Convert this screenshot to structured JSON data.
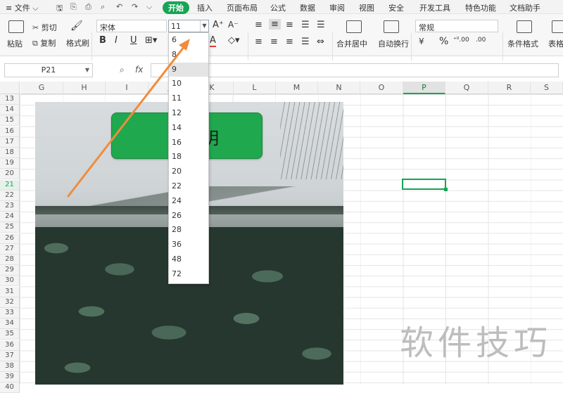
{
  "menubar": {
    "file": "≡ 文件 ⌵",
    "tabs": [
      "开始",
      "插入",
      "页面布局",
      "公式",
      "数据",
      "审阅",
      "视图",
      "安全",
      "开发工具",
      "特色功能",
      "文档助手"
    ],
    "active_tab": "开始"
  },
  "ribbon": {
    "paste": "粘贴",
    "cut": "剪切",
    "copy": "复制",
    "format_painter": "格式刷",
    "font_name": "宋体",
    "font_size": "11",
    "bold": "B",
    "italic": "I",
    "underline": "U",
    "font_color_letter": "A",
    "grow_font": "A⁺",
    "shrink_font": "A⁻",
    "merge_center": "合并居中",
    "wrap_text": "自动换行",
    "number_format": "常规",
    "currency": "¥",
    "percent": "%",
    "inc_decimal": "⁺⁰.00",
    "dec_decimal": ".00",
    "conditional_format": "条件格式",
    "table_style": "表格"
  },
  "formula_bar": {
    "name_box": "P21",
    "fx": "fx",
    "formula": ""
  },
  "columns": [
    "G",
    "H",
    "I",
    "J",
    "K",
    "L",
    "M",
    "N",
    "O",
    "P",
    "Q",
    "R",
    "S"
  ],
  "selected_column": "P",
  "rows": [
    "13",
    "14",
    "15",
    "16",
    "17",
    "18",
    "19",
    "20",
    "21",
    "22",
    "23",
    "24",
    "25",
    "26",
    "27",
    "28",
    "29",
    "30",
    "31",
    "32",
    "33",
    "34",
    "35",
    "36",
    "37",
    "38",
    "39",
    "40"
  ],
  "selected_row": "21",
  "picture": {
    "box_text": "明"
  },
  "font_size_options": [
    "6",
    "8",
    "9",
    "10",
    "11",
    "12",
    "14",
    "16",
    "18",
    "20",
    "22",
    "24",
    "26",
    "28",
    "36",
    "48",
    "72"
  ],
  "hovered_option": "9",
  "watermark": "软件技巧",
  "colors": {
    "accent": "#17a554",
    "arrow": "#f08c3c",
    "green_box": "#1fa84e"
  }
}
